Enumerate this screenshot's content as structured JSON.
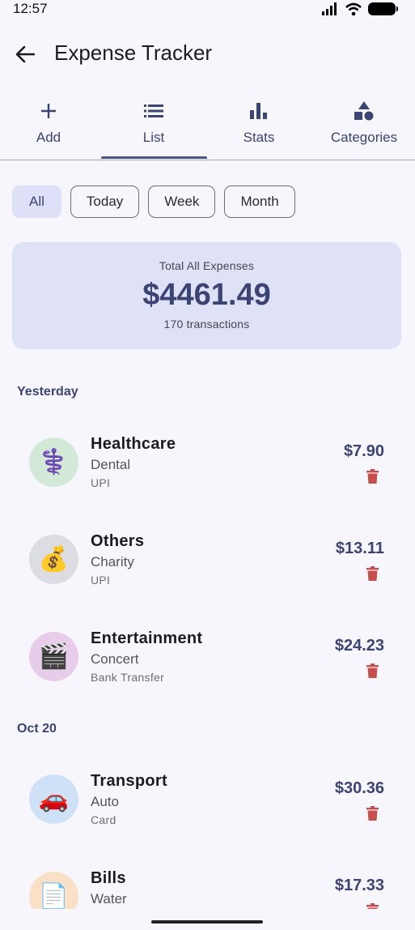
{
  "status_bar": {
    "time": "12:57"
  },
  "app_bar": {
    "title": "Expense Tracker"
  },
  "tabs": [
    {
      "label": "Add",
      "icon": "plus-icon"
    },
    {
      "label": "List",
      "icon": "list-icon",
      "selected": true
    },
    {
      "label": "Stats",
      "icon": "bar-chart-icon"
    },
    {
      "label": "Categories",
      "icon": "categories-icon"
    }
  ],
  "filters": [
    {
      "label": "All",
      "selected": true
    },
    {
      "label": "Today"
    },
    {
      "label": "Week"
    },
    {
      "label": "Month"
    }
  ],
  "summary": {
    "label": "Total All Expenses",
    "amount": "$4461.49",
    "count": "170 transactions"
  },
  "groups": [
    {
      "header": "Yesterday",
      "items": [
        {
          "category": "Healthcare",
          "subcategory": "Dental",
          "method": "UPI",
          "amount": "$7.90",
          "emoji": "⚕️",
          "avatar_color": "#d3e9d8"
        },
        {
          "category": "Others",
          "subcategory": "Charity",
          "method": "UPI",
          "amount": "$13.11",
          "emoji": "💰",
          "avatar_color": "#dcdde2"
        },
        {
          "category": "Entertainment",
          "subcategory": "Concert",
          "method": "Bank Transfer",
          "amount": "$24.23",
          "emoji": "🎬",
          "avatar_color": "#e7cdea"
        }
      ]
    },
    {
      "header": "Oct 20",
      "items": [
        {
          "category": "Transport",
          "subcategory": "Auto",
          "method": "Card",
          "amount": "$30.36",
          "emoji": "🚗",
          "avatar_color": "#cfe1f7"
        },
        {
          "category": "Bills",
          "subcategory": "Water",
          "method": "",
          "amount": "$17.33",
          "emoji": "📄",
          "avatar_color": "#fbe0c8"
        }
      ]
    }
  ],
  "colors": {
    "accent": "#3b4472",
    "delete": "#c7504f",
    "chip_selected": "#dde0f7",
    "card_bg": "#dfe1f7"
  }
}
